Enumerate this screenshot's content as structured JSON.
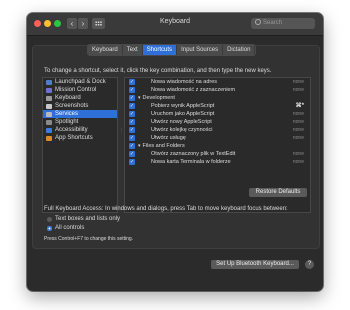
{
  "window": {
    "title": "Keyboard",
    "search_placeholder": "Search"
  },
  "nav": {
    "back": "‹",
    "forward": "›"
  },
  "tabs": [
    "Keyboard",
    "Text",
    "Shortcuts",
    "Input Sources",
    "Dictation"
  ],
  "active_tab": "Shortcuts",
  "instruction": "To change a shortcut, select it, click the key combination, and then type the new keys.",
  "categories": [
    {
      "label": "Launchpad & Dock",
      "icon": "launchpad-icon",
      "selected": false
    },
    {
      "label": "Mission Control",
      "icon": "mission-control-icon",
      "selected": false
    },
    {
      "label": "Keyboard",
      "icon": "keyboard-icon",
      "selected": false
    },
    {
      "label": "Screenshots",
      "icon": "screenshot-icon",
      "selected": false
    },
    {
      "label": "Services",
      "icon": "gear-icon",
      "selected": true
    },
    {
      "label": "Spotlight",
      "icon": "spotlight-icon",
      "selected": false
    },
    {
      "label": "Accessibility",
      "icon": "accessibility-icon",
      "selected": false
    },
    {
      "label": "App Shortcuts",
      "icon": "app-shortcuts-icon",
      "selected": false
    }
  ],
  "shortcuts": [
    {
      "label": "Nowa wiadomość na adres",
      "key": "none",
      "indent": 1,
      "group": false
    },
    {
      "label": "Nowa wiadomość z zaznaczeniem",
      "key": "none",
      "indent": 1,
      "group": false
    },
    {
      "label": "Development",
      "key": "",
      "indent": 0,
      "group": true
    },
    {
      "label": "Pobierz wynik AppleScript",
      "key": "⌘*",
      "indent": 1,
      "group": false
    },
    {
      "label": "Uruchom jako AppleScript",
      "key": "none",
      "indent": 1,
      "group": false
    },
    {
      "label": "Utwórz nowy AppleScript",
      "key": "none",
      "indent": 1,
      "group": false
    },
    {
      "label": "Utwórz kolejkę czynności",
      "key": "none",
      "indent": 1,
      "group": false
    },
    {
      "label": "Utwórz usługę",
      "key": "none",
      "indent": 1,
      "group": false
    },
    {
      "label": "Files and Folders",
      "key": "",
      "indent": 0,
      "group": true
    },
    {
      "label": "Otwórz zaznaczony plik w TextEdit",
      "key": "none",
      "indent": 1,
      "group": false
    },
    {
      "label": "Nowa karta Terminala w folderze",
      "key": "none",
      "indent": 1,
      "group": false
    }
  ],
  "restore_defaults": "Restore Defaults",
  "full_keyboard_access": "Full Keyboard Access: In windows and dialogs, press Tab to move keyboard focus between:",
  "radio_options": [
    {
      "label": "Text boxes and lists only",
      "selected": false
    },
    {
      "label": "All controls",
      "selected": true
    }
  ],
  "hint": "Press Control+F7 to change this setting.",
  "bluetooth_button": "Set Up Bluetooth Keyboard...",
  "help": "?",
  "colors": {
    "accent": "#2f6fd8",
    "window_bg": "#2b2b2b",
    "panel_bg": "#323232"
  }
}
